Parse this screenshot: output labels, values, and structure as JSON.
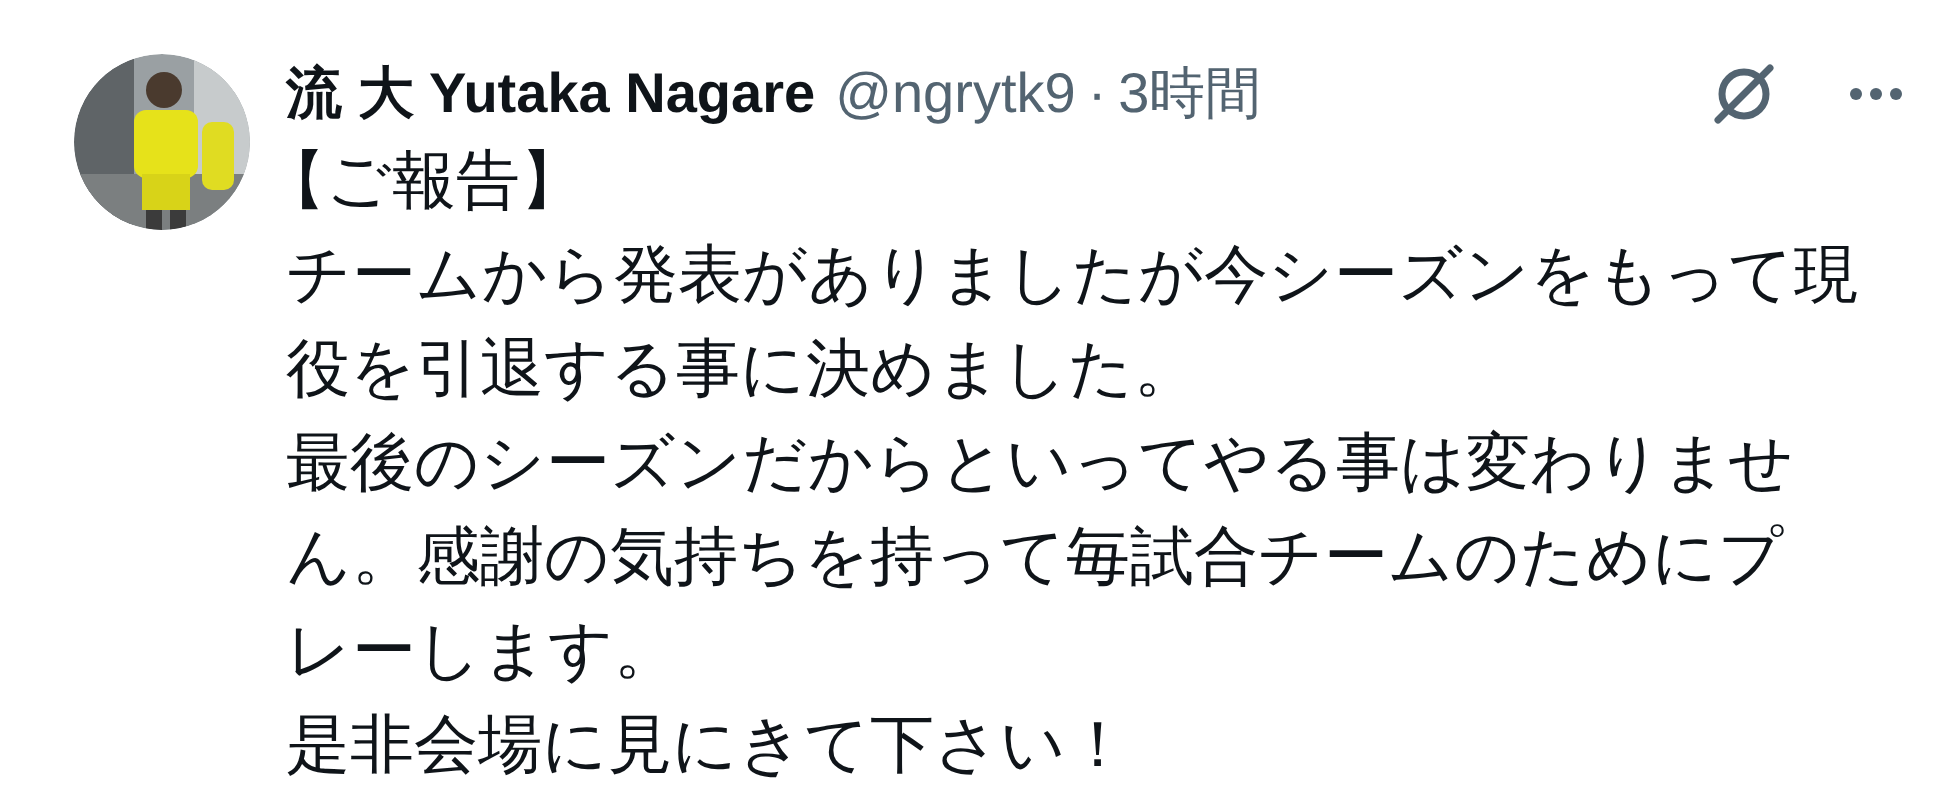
{
  "tweet": {
    "display_name": "流 大 Yutaka Nagare",
    "handle": "@ngrytk9",
    "separator": "·",
    "time": "3時間",
    "lines": [
      "【ご報告】",
      "チームから発表がありましたが今シーズンをもって現",
      "役を引退する事に決めました。",
      "最後のシーズンだからといってやる事は変わりませ",
      "ん。感謝の気持ちを持って毎試合チームのためにプ",
      "レーします。",
      "是非会場に見にきて下さい！"
    ]
  }
}
